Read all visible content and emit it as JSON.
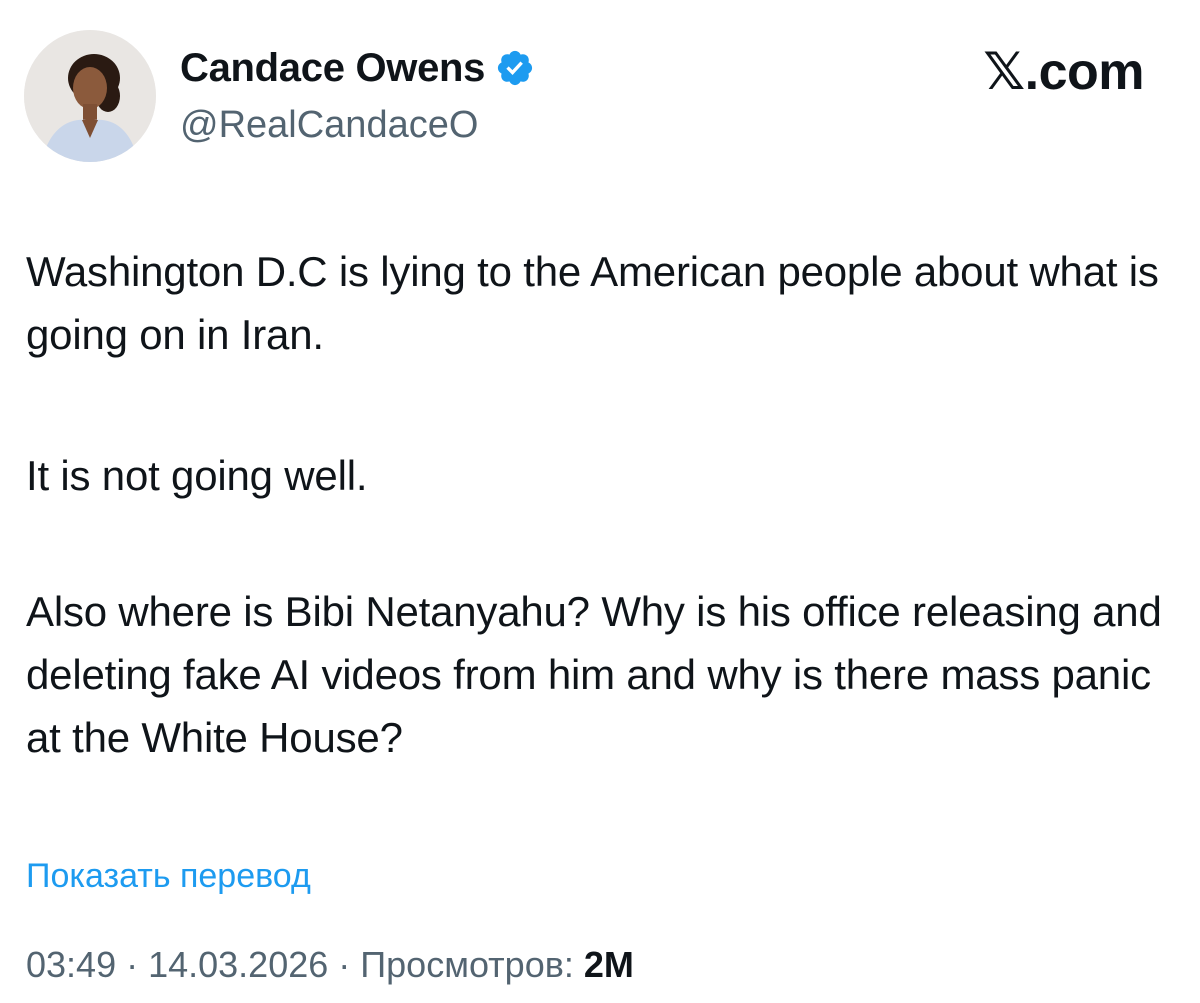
{
  "author": {
    "display_name": "Candace Owens",
    "handle": "@RealCandaceO",
    "verified": true,
    "avatar_icon": "profile-photo"
  },
  "brand": {
    "label": "𝕏.com"
  },
  "tweet": {
    "paragraphs": [
      "Washington D.C is lying to the American people about what is going on in Iran.",
      "It is not going well.",
      "Also where is Bibi Netanyahu? Why is his office releasing and deleting fake AI videos from him and why is there mass panic at the White House?"
    ]
  },
  "translate_link": "Показать перевод",
  "meta": {
    "time": "03:49",
    "separator": " · ",
    "date": "14.03.2026",
    "views_label": "Просмотров: ",
    "views_count": "2M"
  },
  "colors": {
    "text": "#0f1419",
    "secondary": "#536471",
    "link": "#1d9bf0",
    "verified": "#1d9bf0"
  }
}
